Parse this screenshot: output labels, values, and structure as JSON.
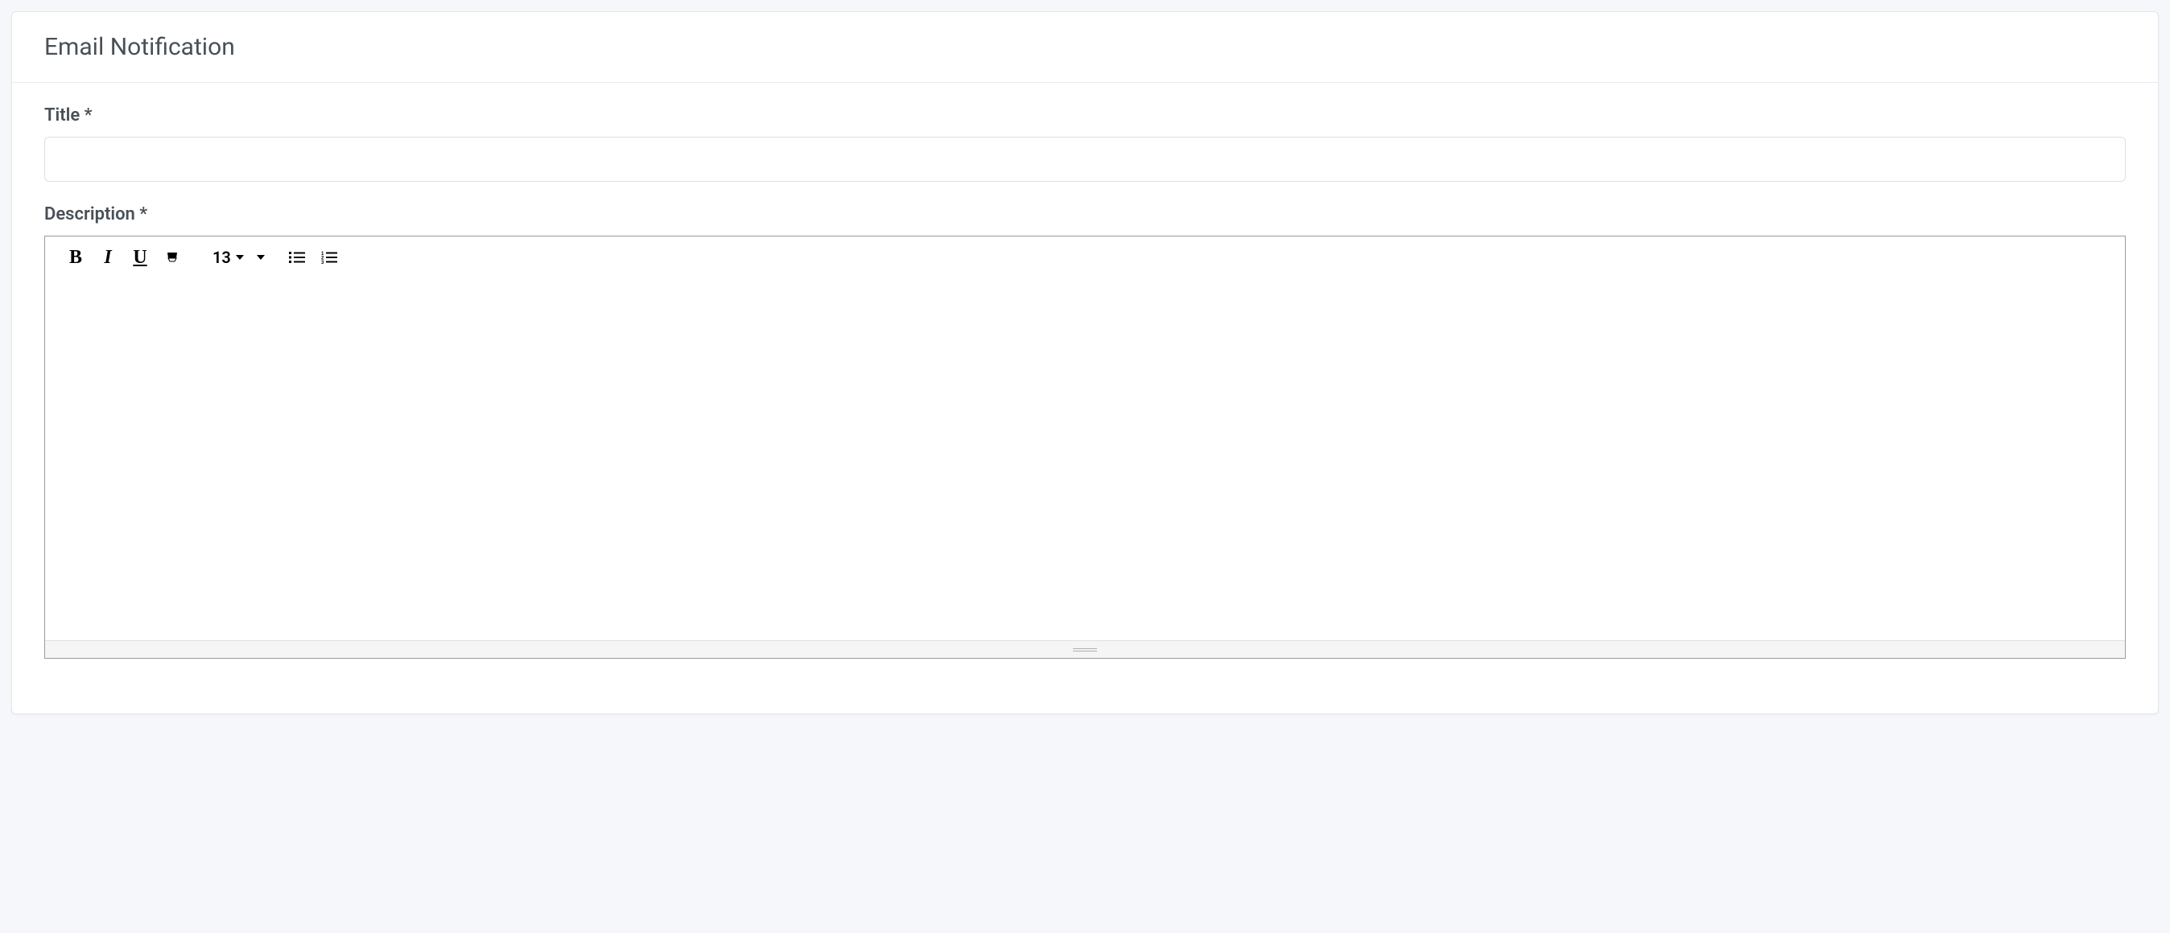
{
  "header": {
    "title": "Email Notification"
  },
  "form": {
    "title_label": "Title *",
    "title_value": "",
    "description_label": "Description *",
    "description_value": ""
  },
  "editor": {
    "toolbar": {
      "bold_glyph": "B",
      "italic_glyph": "I",
      "underline_glyph": "U",
      "font_size": "13"
    }
  }
}
